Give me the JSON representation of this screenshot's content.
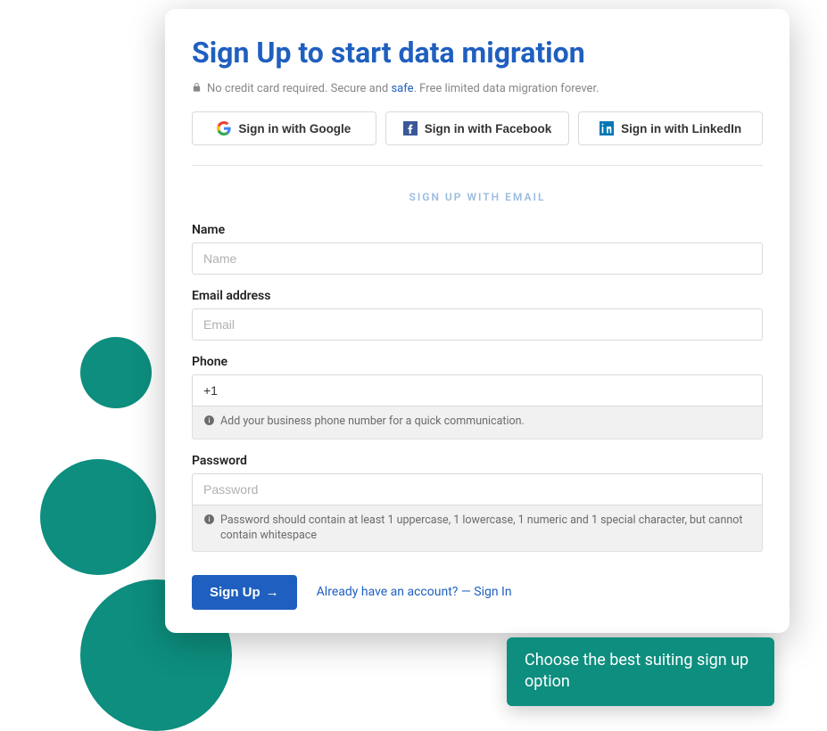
{
  "header": {
    "title": "Sign Up to start data migration",
    "subtitle_prefix": "No credit card required. Secure and ",
    "subtitle_link": "safe",
    "subtitle_suffix": ". Free limited data migration forever."
  },
  "social": {
    "google": "Sign in with Google",
    "facebook": "Sign in with Facebook",
    "linkedin": "Sign in with LinkedIn"
  },
  "email_heading": "SIGN UP WITH EMAIL",
  "fields": {
    "name": {
      "label": "Name",
      "placeholder": "Name",
      "value": ""
    },
    "email": {
      "label": "Email address",
      "placeholder": "Email",
      "value": ""
    },
    "phone": {
      "label": "Phone",
      "placeholder": "",
      "value": "+1",
      "hint": "Add your business phone number for a quick communication."
    },
    "password": {
      "label": "Password",
      "placeholder": "Password",
      "value": "",
      "hint": "Password should contain at least 1 uppercase, 1 lowercase, 1 numeric and 1 special character, but cannot contain whitespace"
    }
  },
  "actions": {
    "signup": "Sign Up",
    "signin_prompt": "Already have an account? — Sign In"
  },
  "tooltip": "Choose the best suiting sign up option"
}
